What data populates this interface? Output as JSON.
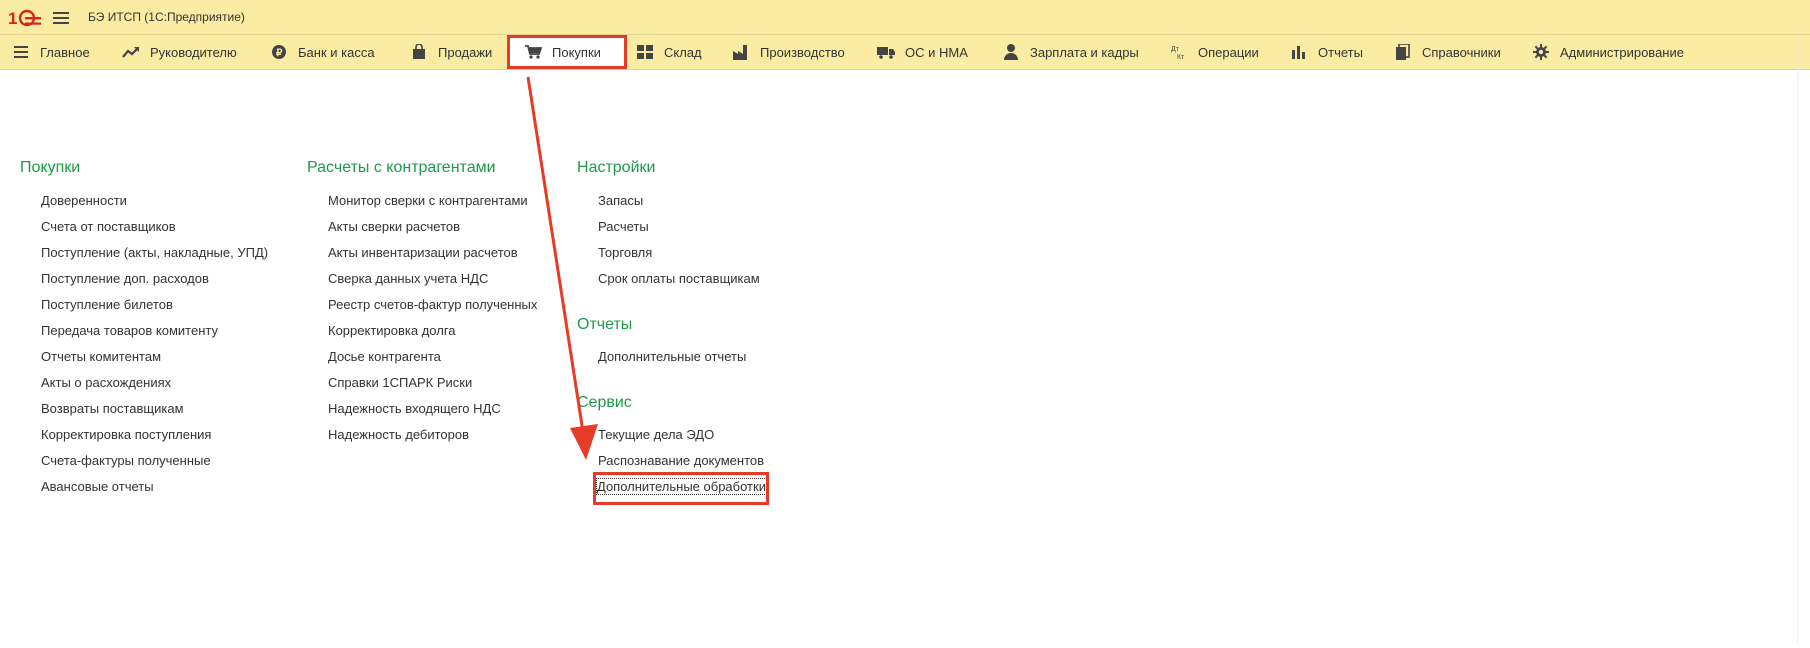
{
  "titlebar": {
    "title": "БЭ ИТСП  (1С:Предприятие)"
  },
  "nav": [
    {
      "label": "Главное",
      "icon": "menu-lines-icon"
    },
    {
      "label": "Руководителю",
      "icon": "trend-up-icon"
    },
    {
      "label": "Банк и касса",
      "icon": "ruble-coin-icon"
    },
    {
      "label": "Продажи",
      "icon": "shopping-bag-icon"
    },
    {
      "label": "Покупки",
      "icon": "shopping-cart-icon",
      "active": true
    },
    {
      "label": "Склад",
      "icon": "warehouse-grid-icon"
    },
    {
      "label": "Производство",
      "icon": "factory-icon"
    },
    {
      "label": "ОС и НМА",
      "icon": "truck-icon"
    },
    {
      "label": "Зарплата и кадры",
      "icon": "person-icon"
    },
    {
      "label": "Операции",
      "icon": "debit-credit-icon"
    },
    {
      "label": "Отчеты",
      "icon": "bar-chart-icon"
    },
    {
      "label": "Справочники",
      "icon": "books-icon"
    },
    {
      "label": "Администрирование",
      "icon": "gear-icon"
    }
  ],
  "columns": {
    "purchases": {
      "title": "Покупки",
      "items": [
        "Доверенности",
        "Счета от поставщиков",
        "Поступление (акты, накладные, УПД)",
        "Поступление доп. расходов",
        "Поступление билетов",
        "Передача товаров комитенту",
        "Отчеты комитентам",
        "Акты о расхождениях",
        "Возвраты поставщикам",
        "Корректировка поступления",
        "Счета-фактуры полученные",
        "Авансовые отчеты"
      ]
    },
    "settlements": {
      "title": "Расчеты с контрагентами",
      "items": [
        "Монитор сверки с контрагентами",
        "Акты сверки расчетов",
        "Акты инвентаризации расчетов",
        "Сверка данных учета НДС",
        "Реестр счетов-фактур полученных",
        "Корректировка долга",
        "Досье контрагента",
        "Справки 1СПАРК Риски",
        "Надежность входящего НДС",
        "Надежность дебиторов"
      ]
    },
    "settings": {
      "title": "Настройки",
      "items": [
        "Запасы",
        "Расчеты",
        "Торговля",
        "Срок оплаты поставщикам"
      ]
    },
    "reports": {
      "title": "Отчеты",
      "items": [
        "Дополнительные отчеты"
      ]
    },
    "service": {
      "title": "Сервис",
      "items": [
        "Текущие дела ЭДО",
        "Распознавание документов",
        "Дополнительные обработки"
      ]
    }
  },
  "colors": {
    "header_bg": "#fbeca3",
    "group_title": "#1f9a4a",
    "annotation_red": "#e53b27"
  }
}
